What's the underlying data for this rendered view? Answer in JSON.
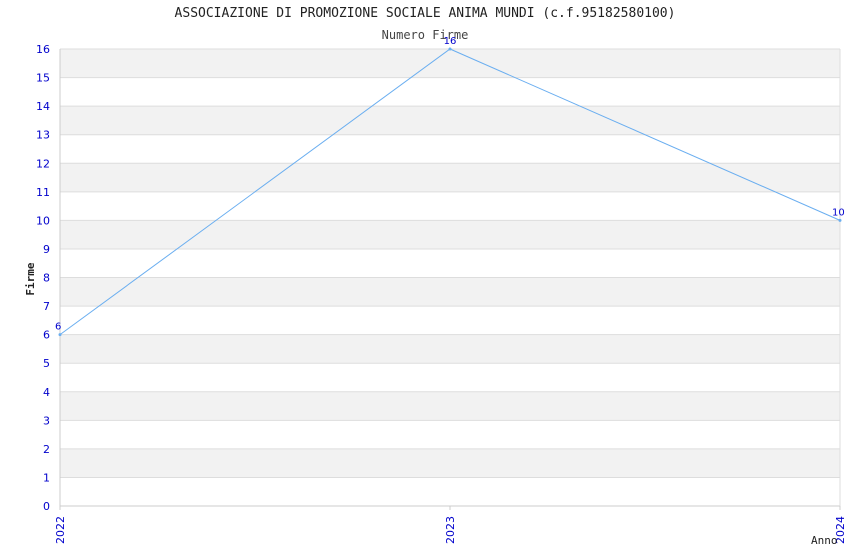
{
  "chart_data": {
    "type": "line",
    "title": "ASSOCIAZIONE DI PROMOZIONE SOCIALE ANIMA MUNDI (c.f.95182580100)",
    "subtitle": "Numero Firme",
    "xlabel": "Anno",
    "ylabel": "Firme",
    "categories": [
      "2022",
      "2023",
      "2024"
    ],
    "series": [
      {
        "values": [
          6,
          16,
          10
        ]
      }
    ],
    "ylim": [
      0,
      16
    ],
    "yticks": [
      0,
      1,
      2,
      3,
      4,
      5,
      6,
      7,
      8,
      9,
      10,
      11,
      12,
      13,
      14,
      15,
      16
    ],
    "grid": true,
    "colors": {
      "line": "#6aaef0",
      "tick_text": "#0000cc",
      "band": "#f2f2f2",
      "gridline": "#dddddd",
      "axis": "#cccccc"
    }
  }
}
